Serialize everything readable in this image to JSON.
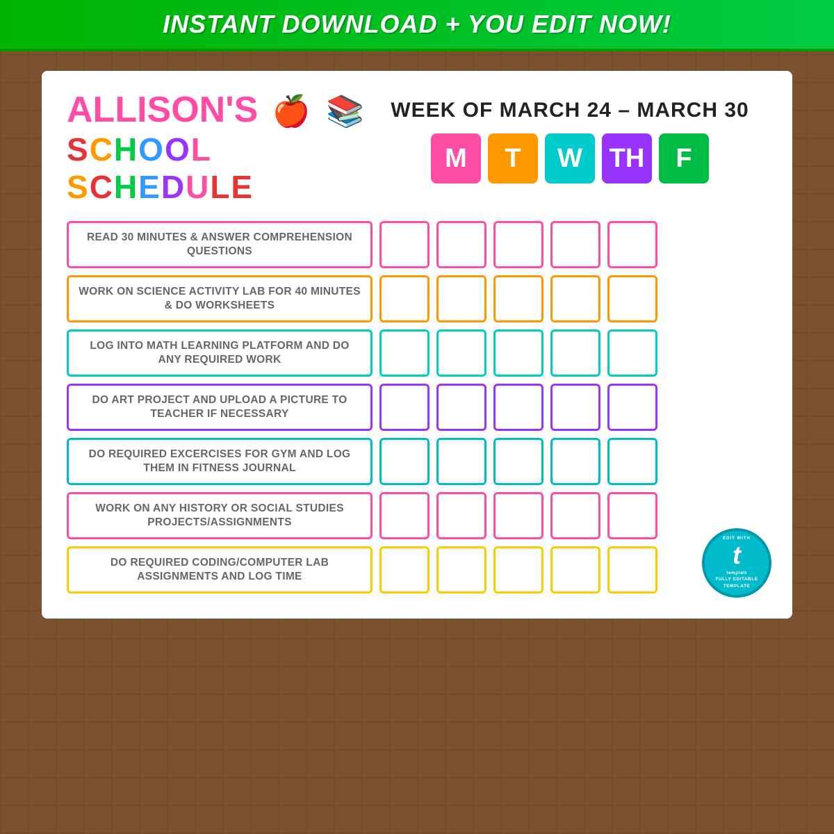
{
  "banner": {
    "text": "INSTANT DOWNLOAD + YOU EDIT NOW!"
  },
  "header": {
    "name": "ALLISON'S",
    "schedule": "SCHOOL SCHEDULE",
    "week_text": "WEEK OF MARCH 24 – MARCH 30"
  },
  "days": [
    {
      "label": "M",
      "color_class": "day-m"
    },
    {
      "label": "T",
      "color_class": "day-t"
    },
    {
      "label": "W",
      "color_class": "day-w"
    },
    {
      "label": "TH",
      "color_class": "day-th"
    },
    {
      "label": "F",
      "color_class": "day-f"
    }
  ],
  "tasks": [
    {
      "text": "READ 30 MINUTES & ANSWER COMPREHENSION QUESTIONS",
      "border_class": "task-pink",
      "cb_class": "cb-pink"
    },
    {
      "text": "WORK ON SCIENCE ACTIVITY LAB FOR 40 MINUTES & DO WORKSHEETS",
      "border_class": "task-orange",
      "cb_class": "cb-orange"
    },
    {
      "text": "LOG INTO MATH LEARNING PLATFORM AND DO ANY REQUIRED WORK",
      "border_class": "task-teal",
      "cb_class": "cb-teal"
    },
    {
      "text": "DO ART PROJECT AND UPLOAD A PICTURE TO TEACHER IF NECESSARY",
      "border_class": "task-purple",
      "cb_class": "cb-purple"
    },
    {
      "text": "DO REQUIRED EXCERCISES FOR GYM AND LOG THEM IN FITNESS JOURNAL",
      "border_class": "task-cyan",
      "cb_class": "cb-cyan"
    },
    {
      "text": "WORK ON ANY HISTORY OR SOCIAL STUDIES PROJECTS/ASSIGNMENTS",
      "border_class": "task-hotpink",
      "cb_class": "cb-hotpink"
    },
    {
      "text": "DO REQUIRED CODING/COMPUTER LAB ASSIGNMENTS AND LOG TIME",
      "border_class": "task-gold",
      "cb_class": "cb-gold"
    }
  ],
  "templett": {
    "letter": "t",
    "line1": "EDIT WITH",
    "line2": "templett",
    "line3": "FULLY EDITABLE TEMPLATE"
  }
}
